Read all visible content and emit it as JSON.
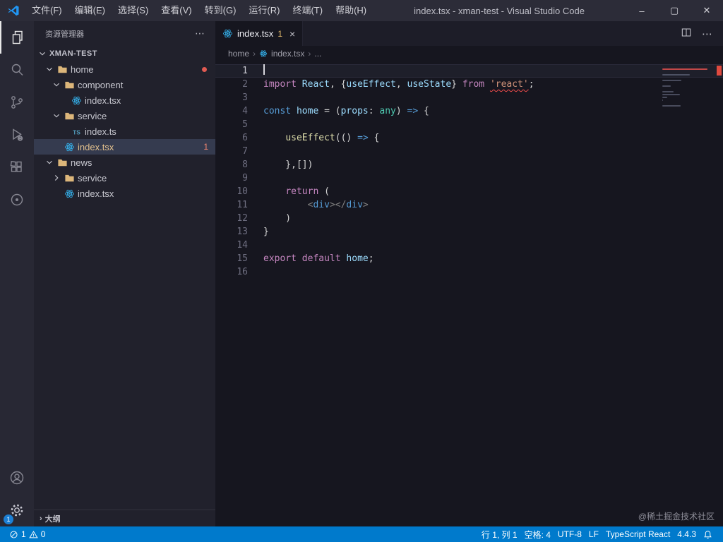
{
  "title_bar": {
    "menus": [
      "文件(F)",
      "编辑(E)",
      "选择(S)",
      "查看(V)",
      "转到(G)",
      "运行(R)",
      "终端(T)",
      "帮助(H)"
    ],
    "title": "index.tsx - xman-test - Visual Studio Code"
  },
  "icons": {
    "minimize": "–",
    "maximize": "▢",
    "window_close": "✕",
    "more": "⋯",
    "tab_close": "×",
    "crumb_sep": "›",
    "outline_chevron": "›"
  },
  "activity_bar": {
    "settings_badge": "1"
  },
  "sidebar": {
    "header_title": "资源管理器",
    "outline_label": "大纲",
    "tree": [
      {
        "label": "XMAN-TEST",
        "kind": "root",
        "depth": 0,
        "chevron": "down"
      },
      {
        "label": "home",
        "kind": "folder",
        "depth": 1,
        "chevron": "down",
        "dot": true
      },
      {
        "label": "component",
        "kind": "folder",
        "depth": 2,
        "chevron": "down"
      },
      {
        "label": "index.tsx",
        "kind": "file",
        "icon": "react",
        "depth": 3
      },
      {
        "label": "service",
        "kind": "folder",
        "depth": 2,
        "chevron": "down"
      },
      {
        "label": "index.ts",
        "kind": "file",
        "icon": "ts",
        "depth": 3
      },
      {
        "label": "index.tsx",
        "kind": "file",
        "icon": "react",
        "depth": 2,
        "selected": true,
        "badge": "1",
        "modified": true
      },
      {
        "label": "news",
        "kind": "folder",
        "depth": 1,
        "chevron": "down"
      },
      {
        "label": "service",
        "kind": "folder",
        "depth": 2,
        "chevron": "right"
      },
      {
        "label": "index.tsx",
        "kind": "file",
        "icon": "react",
        "depth": 2
      }
    ]
  },
  "editor": {
    "tab": {
      "label": "index.tsx",
      "badge": "1"
    },
    "breadcrumb": {
      "crumb1": "home",
      "crumb2": "index.tsx",
      "crumb3": "..."
    },
    "minimap_error_line": 2,
    "code": {
      "lines": [
        [],
        [
          [
            "kw",
            "import"
          ],
          [
            "pl",
            " "
          ],
          [
            "var",
            "React"
          ],
          [
            "pl",
            ", {"
          ],
          [
            "var",
            "useEffect"
          ],
          [
            "pl",
            ", "
          ],
          [
            "var",
            "useState"
          ],
          [
            "pl",
            "} "
          ],
          [
            "kw",
            "from"
          ],
          [
            "pl",
            " "
          ],
          [
            "strerr",
            "'react'"
          ],
          [
            "pl",
            ";"
          ]
        ],
        [],
        [
          [
            "kw2",
            "const"
          ],
          [
            "pl",
            " "
          ],
          [
            "var",
            "home"
          ],
          [
            "pl",
            " = ("
          ],
          [
            "var",
            "props"
          ],
          [
            "pl",
            ": "
          ],
          [
            "type",
            "any"
          ],
          [
            "pl",
            ") "
          ],
          [
            "op",
            "=>"
          ],
          [
            "pl",
            " {"
          ]
        ],
        [],
        [
          [
            "pl",
            "    "
          ],
          [
            "fn",
            "useEffect"
          ],
          [
            "pl",
            "(() "
          ],
          [
            "op",
            "=>"
          ],
          [
            "pl",
            " {"
          ]
        ],
        [],
        [
          [
            "pl",
            "    },[])"
          ]
        ],
        [],
        [
          [
            "pl",
            "    "
          ],
          [
            "kw",
            "return"
          ],
          [
            "pl",
            " ("
          ]
        ],
        [
          [
            "pl",
            "        "
          ],
          [
            "tagp",
            "<"
          ],
          [
            "tag",
            "div"
          ],
          [
            "tagp",
            "></"
          ],
          [
            "tag",
            "div"
          ],
          [
            "tagp",
            ">"
          ]
        ],
        [
          [
            "pl",
            "    )"
          ]
        ],
        [
          [
            "pl",
            "}"
          ]
        ],
        [],
        [
          [
            "kw",
            "export"
          ],
          [
            "pl",
            " "
          ],
          [
            "kw",
            "default"
          ],
          [
            "pl",
            " "
          ],
          [
            "var",
            "home"
          ],
          [
            "pl",
            ";"
          ]
        ],
        []
      ]
    }
  },
  "status_bar": {
    "errors": "1",
    "warnings": "0",
    "cursor_position": "行 1, 列 1",
    "indentation": "空格: 4",
    "encoding": "UTF-8",
    "eol": "LF",
    "language": "TypeScript React",
    "ts_version": "4.4.3"
  },
  "watermark": "@稀土掘金技术社区",
  "colors": {
    "statusbar_accent": "#007acc",
    "error": "#f14c4c",
    "git_modified": "#e2c08d",
    "selection_bg": "#353b4f"
  }
}
